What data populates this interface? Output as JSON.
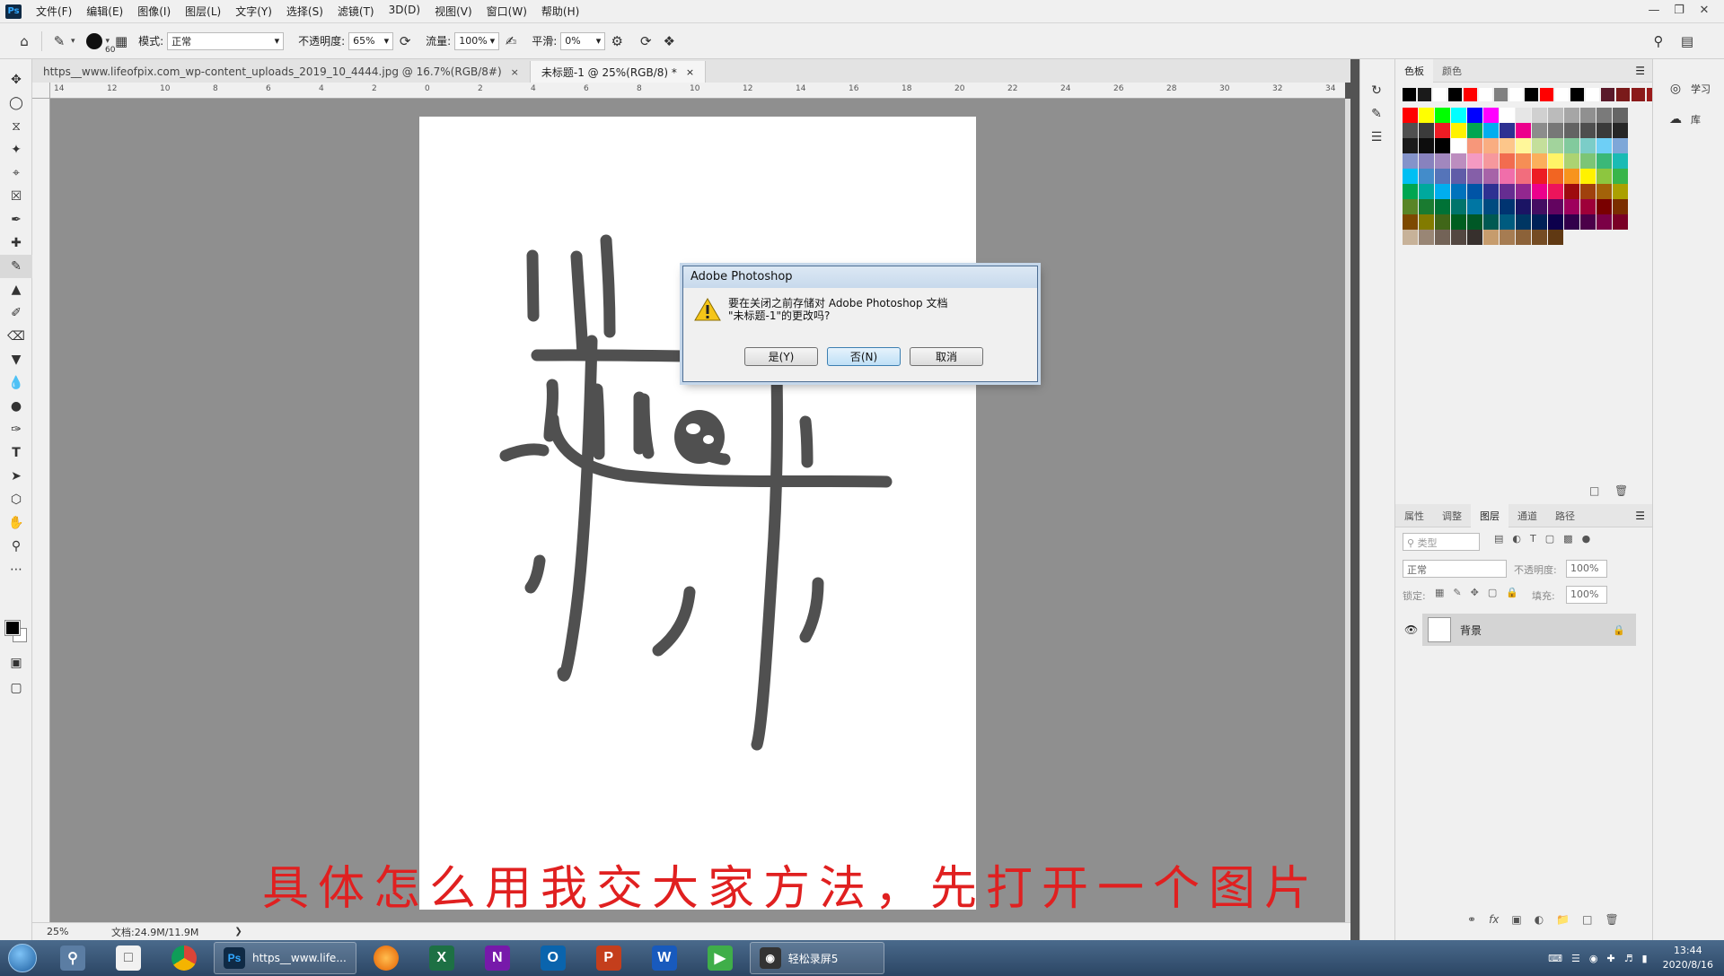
{
  "menubar": {
    "items": [
      "文件(F)",
      "编辑(E)",
      "图像(I)",
      "图层(L)",
      "文字(Y)",
      "选择(S)",
      "滤镜(T)",
      "3D(D)",
      "视图(V)",
      "窗口(W)",
      "帮助(H)"
    ]
  },
  "options": {
    "brush_size": "60",
    "mode_label": "模式:",
    "mode_value": "正常",
    "opacity_label": "不透明度:",
    "opacity_value": "65%",
    "flow_label": "流量:",
    "flow_value": "100%",
    "smooth_label": "平滑:",
    "smooth_value": "0%"
  },
  "tabs": [
    {
      "label": "https__www.lifeofpix.com_wp-content_uploads_2019_10_4444.jpg @ 16.7%(RGB/8#)",
      "close": "×"
    },
    {
      "label": "未标题-1 @ 25%(RGB/8) *",
      "close": "×"
    }
  ],
  "ruler": {
    "top_ticks": [
      "14",
      "12",
      "10",
      "8",
      "6",
      "4",
      "2",
      "0",
      "2",
      "4",
      "6",
      "8",
      "10",
      "12",
      "14",
      "16",
      "18",
      "20",
      "22",
      "24",
      "26",
      "28",
      "30",
      "32",
      "34"
    ]
  },
  "status": {
    "zoom": "25%",
    "doc": "文档:24.9M/11.9M"
  },
  "dialog": {
    "title": "Adobe Photoshop",
    "message_line1": "要在关闭之前存储对 Adobe Photoshop 文档",
    "message_line2": "\"未标题-1\"的更改吗?",
    "yes": "是(Y)",
    "no": "否(N)",
    "cancel": "取消"
  },
  "subtitle": "具体怎么用我交大家方法，先打开一个图片",
  "swatches_panel": {
    "tabs": [
      "色板",
      "颜色"
    ],
    "top_row": [
      "#000000",
      "#1a1a1a",
      "#ffffff",
      "#000000",
      "#ff0000",
      "#ffffff",
      "#808080",
      "#ffffff",
      "#000000",
      "#ff0000",
      "#ffffff",
      "#000000",
      "#ffffff",
      "#5a1a2a",
      "#7a1a1a",
      "#8b1a1a",
      "#9a1a1a",
      "#a01a1a"
    ],
    "grid": [
      "#ff0000",
      "#ffff00",
      "#00ff00",
      "#00ffff",
      "#0000ff",
      "#ff00ff",
      "#ffffff",
      "#e6e6e6",
      "#d0d0d0",
      "#bbbbbb",
      "#a6a6a6",
      "#909090",
      "#7a7a7a",
      "#656565",
      "#505050",
      "#3b3b3b",
      "#ed1c24",
      "#fff200",
      "#00a651",
      "#00aeef",
      "#2e3192",
      "#ec008c",
      "#8c8c8c",
      "#777777",
      "#636363",
      "#4e4e4e",
      "#3a3a3a",
      "#262626",
      "#1a1a1a",
      "#0d0d0d",
      "#000000",
      "#ffffff",
      "#f7977a",
      "#f9ad81",
      "#fdc68a",
      "#fff79a",
      "#c4df9b",
      "#a2d39c",
      "#82ca9d",
      "#7bcdc8",
      "#6ecff6",
      "#7ea7d8",
      "#8493ca",
      "#8882be",
      "#a187be",
      "#bc8dbf",
      "#f49ac2",
      "#f6989d",
      "#f26c4f",
      "#f68e55",
      "#fbaf5c",
      "#fff467",
      "#acd372",
      "#7cc576",
      "#3bb878",
      "#1abbb4",
      "#00bff3",
      "#438cca",
      "#5574b9",
      "#605ca8",
      "#855fa8",
      "#a763a8",
      "#f06eaa",
      "#f26d7d",
      "#ed1c24",
      "#f26522",
      "#f7941d",
      "#fff200",
      "#8dc63f",
      "#39b54a",
      "#00a651",
      "#00a99d",
      "#00aeef",
      "#0072bc",
      "#0054a6",
      "#2e3192",
      "#662d91",
      "#92278f",
      "#ec008c",
      "#ed145b",
      "#9e0b0f",
      "#a0410d",
      "#a36209",
      "#aba000",
      "#598527",
      "#1a7b30",
      "#007236",
      "#00746b",
      "#0076a3",
      "#004b80",
      "#003471",
      "#1b1464",
      "#440e62",
      "#630460",
      "#9e005d",
      "#9e0039",
      "#790000",
      "#7b2e00",
      "#7d4900",
      "#827b00",
      "#406618",
      "#005e20",
      "#005826",
      "#005952",
      "#005b7f",
      "#003663",
      "#002157",
      "#0d004c",
      "#32004b",
      "#4b0049",
      "#7b0046",
      "#7a0026",
      "#c7b299",
      "#998675",
      "#736357",
      "#534741",
      "#37302d",
      "#c69c6d",
      "#a67c52",
      "#8c6239",
      "#754c24",
      "#603913"
    ]
  },
  "learn_panel": {
    "items": [
      {
        "icon": "lightbulb-icon",
        "label": "学习"
      },
      {
        "icon": "library-icon",
        "label": "库"
      }
    ]
  },
  "layers_panel": {
    "tabs": [
      "属性",
      "调整",
      "图层",
      "通道",
      "路径"
    ],
    "filter_placeholder": "类型",
    "blend": "正常",
    "opacity_label": "不透明度:",
    "opacity_value": "100%",
    "lock_label": "锁定:",
    "fill_label": "填充:",
    "fill_value": "100%",
    "layer_name": "背景"
  },
  "taskbar": {
    "ps_window": "https__www.life...",
    "recorder_window": "轻松录屏5",
    "time": "13:44",
    "date": "2020/8/16"
  }
}
